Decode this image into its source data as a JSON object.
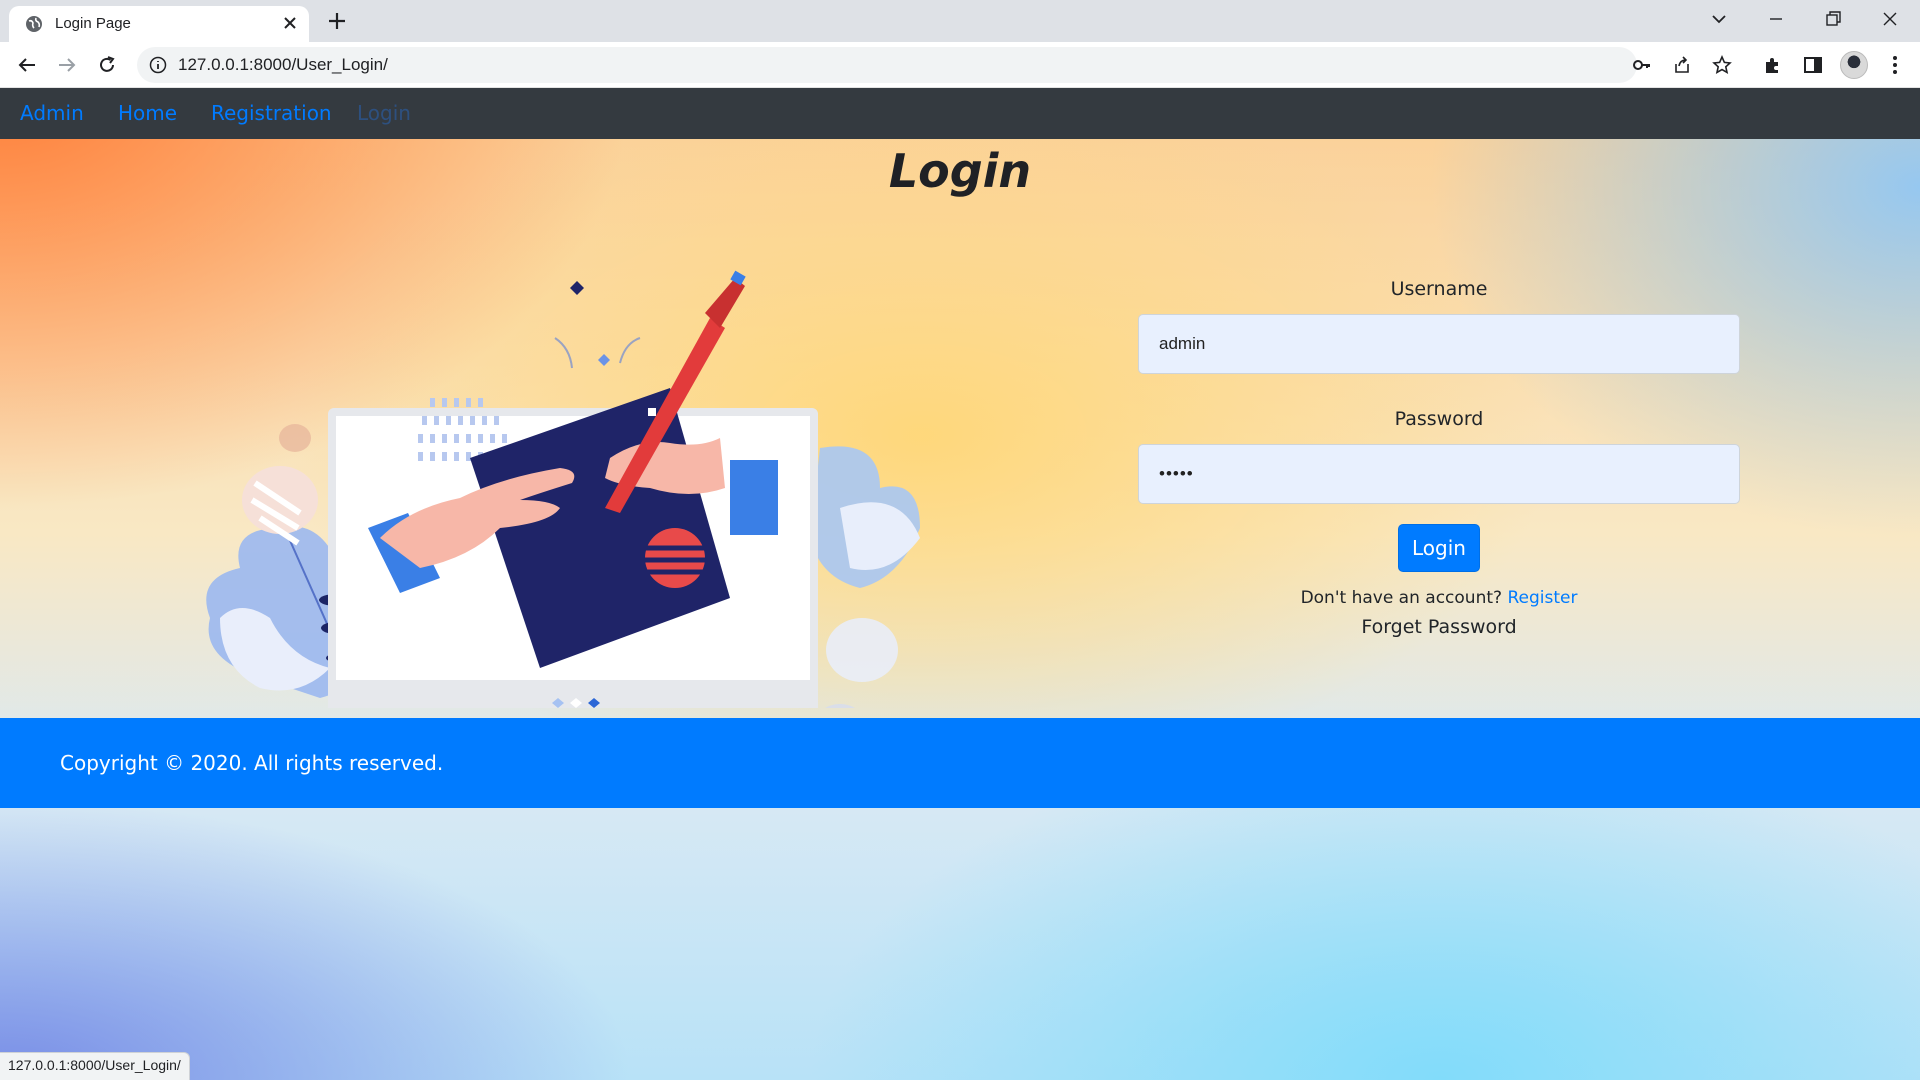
{
  "browser": {
    "tab_title": "Login Page",
    "url": "127.0.0.1:8000/User_Login/",
    "status_url": "127.0.0.1:8000/User_Login/"
  },
  "nav": {
    "items": [
      {
        "label": "Admin"
      },
      {
        "label": "Home"
      },
      {
        "label": "Registration"
      },
      {
        "label": "Login"
      }
    ]
  },
  "page": {
    "title": "Login"
  },
  "form": {
    "username_label": "Username",
    "username_value": "admin",
    "password_label": "Password",
    "password_value": "•••••",
    "login_label": "Login",
    "signup_prompt": "Don't have an account?",
    "register_link": "Register",
    "forgot_label": "Forget Password"
  },
  "footer": {
    "copyright": "Copyright © 2020. All rights reserved."
  },
  "colors": {
    "primary": "#007bff",
    "navbar": "#343a40"
  }
}
